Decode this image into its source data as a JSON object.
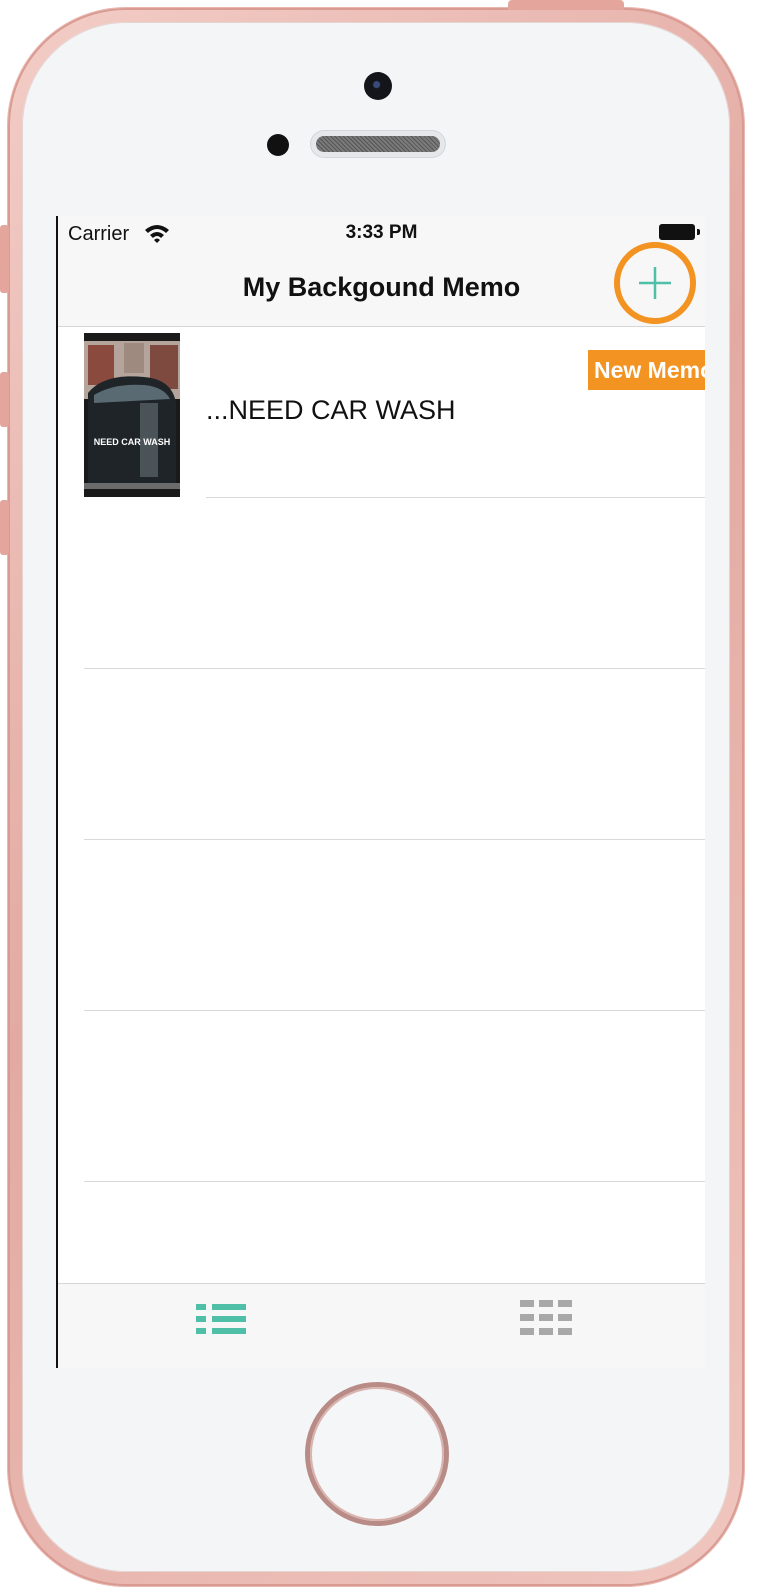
{
  "status_bar": {
    "carrier": "Carrier",
    "time": "3:33 PM"
  },
  "nav": {
    "title": "My Backgound Memo",
    "add_icon": "plus-icon",
    "add_highlight_color": "#f39321",
    "accent_color": "#4fbfa8"
  },
  "tooltip": {
    "label": "New Memo"
  },
  "memos": [
    {
      "title": "...NEED CAR WASH",
      "thumbnail_caption": "NEED CAR WASH"
    }
  ],
  "tab_bar": {
    "tabs": [
      {
        "icon": "list-icon",
        "selected": true,
        "color": "#4fbfa8"
      },
      {
        "icon": "grid-icon",
        "selected": false,
        "color": "#a8a8a8"
      }
    ]
  }
}
